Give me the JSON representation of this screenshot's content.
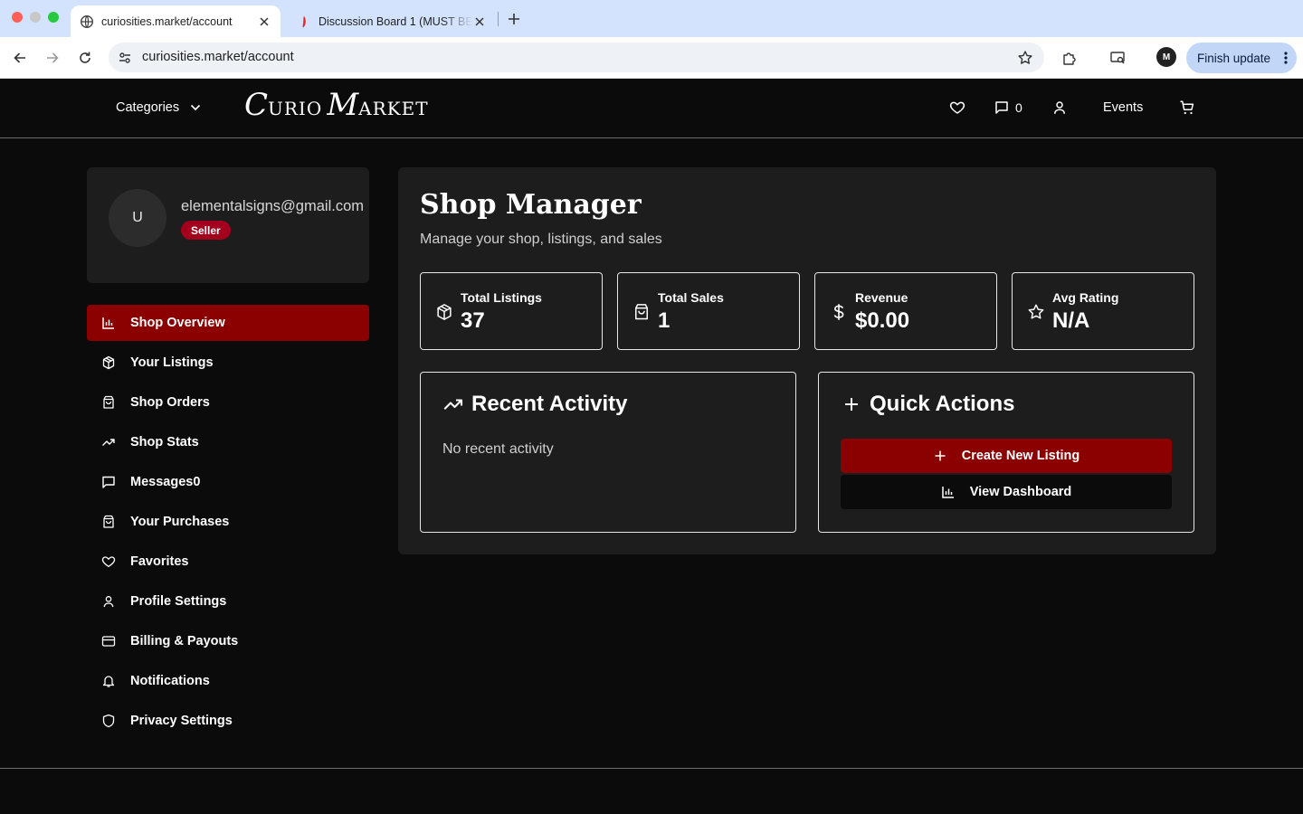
{
  "browser": {
    "tabs": [
      {
        "title": "curiosities.market/account",
        "active": true,
        "icon": "globe-icon"
      },
      {
        "title": "Discussion Board 1 (MUST BE",
        "active": false,
        "icon": "canvas-icon"
      }
    ],
    "url": "curiosities.market/account",
    "finish_update_label": "Finish update",
    "profile_initial": "M"
  },
  "header": {
    "categories_label": "Categories",
    "logo": {
      "c": "C",
      "urio": "URIO",
      "m": "M",
      "arket": "ARKET"
    },
    "message_count": "0",
    "events_label": "Events"
  },
  "profile": {
    "avatar_initial": "U",
    "email": "elementalsigns@gmail.com",
    "role_badge": "Seller"
  },
  "nav": {
    "items": [
      {
        "label": "Shop Overview",
        "icon": "bar-chart-icon",
        "active": true
      },
      {
        "label": "Your Listings",
        "icon": "package-icon"
      },
      {
        "label": "Shop Orders",
        "icon": "shopping-bag-icon"
      },
      {
        "label": "Shop Stats",
        "icon": "trending-up-icon"
      },
      {
        "label": "Messages0",
        "icon": "message-square-icon"
      },
      {
        "label": "Your Purchases",
        "icon": "shopping-bag-icon"
      },
      {
        "label": "Favorites",
        "icon": "heart-icon"
      },
      {
        "label": "Profile Settings",
        "icon": "user-icon"
      },
      {
        "label": "Billing & Payouts",
        "icon": "credit-card-icon"
      },
      {
        "label": "Notifications",
        "icon": "bell-icon"
      },
      {
        "label": "Privacy Settings",
        "icon": "shield-icon"
      }
    ]
  },
  "main": {
    "title": "Shop Manager",
    "subtitle": "Manage your shop, listings, and sales",
    "stats": [
      {
        "label": "Total Listings",
        "value": "37",
        "icon": "package-icon"
      },
      {
        "label": "Total Sales",
        "value": "1",
        "icon": "shopping-bag-icon"
      },
      {
        "label": "Revenue",
        "value": "$0.00",
        "icon": "dollar-icon"
      },
      {
        "label": "Avg Rating",
        "value": "N/A",
        "icon": "star-icon"
      }
    ],
    "recent_activity": {
      "title": "Recent Activity",
      "empty_text": "No recent activity"
    },
    "quick_actions": {
      "title": "Quick Actions",
      "create_label": "Create New Listing",
      "dashboard_label": "View Dashboard"
    }
  },
  "colors": {
    "accent": "#8b0000",
    "badge": "#a3001d",
    "background": "#0b0b0b",
    "card": "#1d1d1d"
  }
}
